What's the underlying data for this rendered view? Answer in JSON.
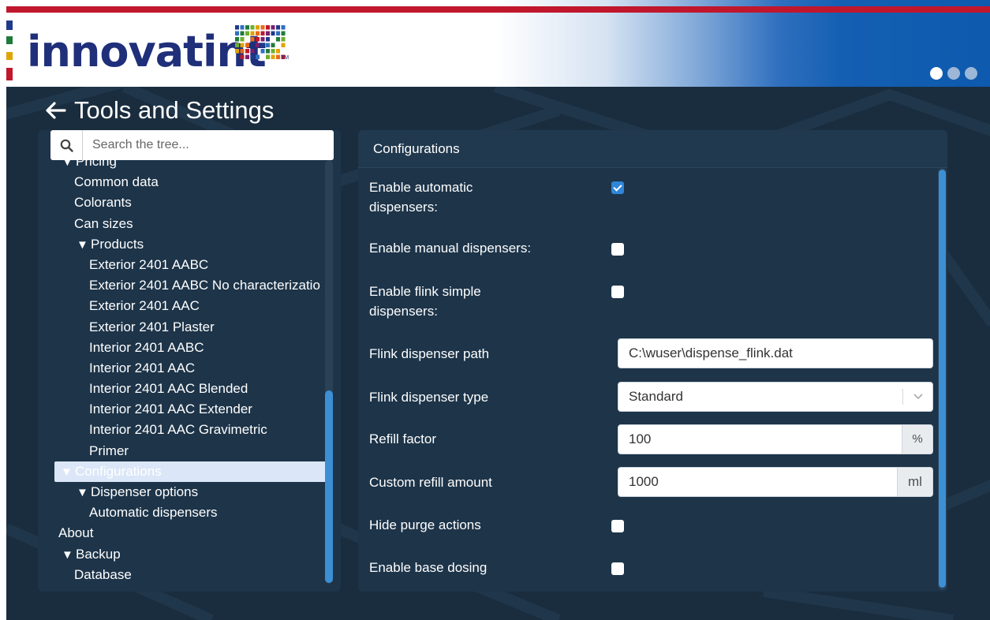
{
  "header": {
    "logo_text": "innovatint",
    "logo_trademark": "TM",
    "page_indicators": [
      true,
      false,
      false
    ]
  },
  "page": {
    "title": "Tools and Settings"
  },
  "tree": {
    "search_placeholder": "Search the tree...",
    "items": [
      {
        "label": "Pricing",
        "level": "lvl0-exp",
        "caret": "▼",
        "selected": false
      },
      {
        "label": "Common data",
        "level": "lvl1",
        "caret": "",
        "selected": false
      },
      {
        "label": "Colorants",
        "level": "lvl1",
        "caret": "",
        "selected": false
      },
      {
        "label": "Can sizes",
        "level": "lvl1",
        "caret": "",
        "selected": false
      },
      {
        "label": "Products",
        "level": "lvl1-exp",
        "caret": "▼",
        "selected": false
      },
      {
        "label": "Exterior 2401 AABC",
        "level": "lvl2",
        "caret": "",
        "selected": false
      },
      {
        "label": "Exterior 2401 AABC No characterizatio",
        "level": "lvl2",
        "caret": "",
        "selected": false
      },
      {
        "label": "Exterior 2401 AAC",
        "level": "lvl2",
        "caret": "",
        "selected": false
      },
      {
        "label": "Exterior 2401 Plaster",
        "level": "lvl2",
        "caret": "",
        "selected": false
      },
      {
        "label": "Interior 2401 AABC",
        "level": "lvl2",
        "caret": "",
        "selected": false
      },
      {
        "label": "Interior 2401 AAC",
        "level": "lvl2",
        "caret": "",
        "selected": false
      },
      {
        "label": "Interior 2401 AAC Blended",
        "level": "lvl2",
        "caret": "",
        "selected": false
      },
      {
        "label": "Interior 2401 AAC Extender",
        "level": "lvl2",
        "caret": "",
        "selected": false
      },
      {
        "label": "Interior 2401 AAC Gravimetric",
        "level": "lvl2",
        "caret": "",
        "selected": false
      },
      {
        "label": "Primer",
        "level": "lvl2",
        "caret": "",
        "selected": false
      },
      {
        "label": "Configurations",
        "level": "lvl1-exp",
        "caret": "▼",
        "selected": true
      },
      {
        "label": "Dispenser options",
        "level": "lvl1-exp",
        "caret": "▼",
        "selected": false
      },
      {
        "label": "Automatic dispensers",
        "level": "lvl2",
        "caret": "",
        "selected": false
      },
      {
        "label": "About",
        "level": "lvl0",
        "caret": "",
        "selected": false
      },
      {
        "label": "Backup",
        "level": "lvl0-exp",
        "caret": "▼",
        "selected": false
      },
      {
        "label": "Database",
        "level": "lvl1",
        "caret": "",
        "selected": false
      }
    ]
  },
  "config": {
    "title": "Configurations",
    "enable_automatic_label": "Enable automatic dispensers:",
    "enable_automatic_checked": true,
    "enable_manual_label": "Enable manual dispensers:",
    "enable_manual_checked": false,
    "enable_flink_label": "Enable flink simple dispensers:",
    "enable_flink_checked": false,
    "flink_path_label": "Flink dispenser path",
    "flink_path_value": "C:\\wuser\\dispense_flink.dat",
    "flink_type_label": "Flink dispenser type",
    "flink_type_value": "Standard",
    "refill_factor_label": "Refill factor",
    "refill_factor_value": "100",
    "refill_factor_unit": "%",
    "custom_refill_label": "Custom refill amount",
    "custom_refill_value": "1000",
    "custom_refill_unit": "ml",
    "hide_purge_label": "Hide purge actions",
    "hide_purge_checked": false,
    "base_dosing_label": "Enable base dosing",
    "base_dosing_checked": false
  },
  "colors": {
    "brand_red": "#c0172d",
    "brand_navy": "#1f2f7a",
    "panel_bg": "#1d3449",
    "accent_blue": "#3d8fd4",
    "selection_bg": "#dbe7f8"
  }
}
